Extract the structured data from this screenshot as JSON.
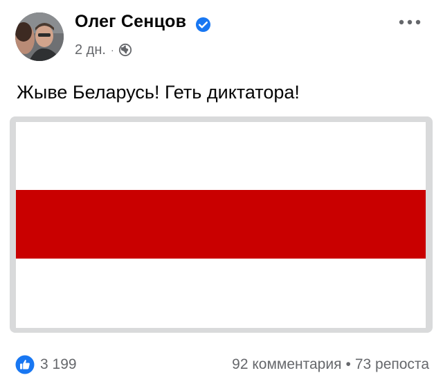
{
  "post": {
    "author": "Олег Сенцов",
    "verified": true,
    "time": "2 дн.",
    "separator": "·",
    "audience_icon": "globe-icon",
    "text": "Жыве Беларусь! Геть диктатора!",
    "image": {
      "description_icon": "belarus-white-red-white-flag",
      "colors": {
        "top": "#ffffff",
        "middle": "#c90000",
        "bottom": "#ffffff"
      }
    },
    "reactions": {
      "icon": "like-icon",
      "count": "3 199"
    },
    "comments": "92 комментария",
    "stats_separator": "•",
    "shares": "73 репоста"
  },
  "colors": {
    "accent": "#1877f2",
    "secondary_text": "#65676b",
    "primary_text": "#050505"
  }
}
